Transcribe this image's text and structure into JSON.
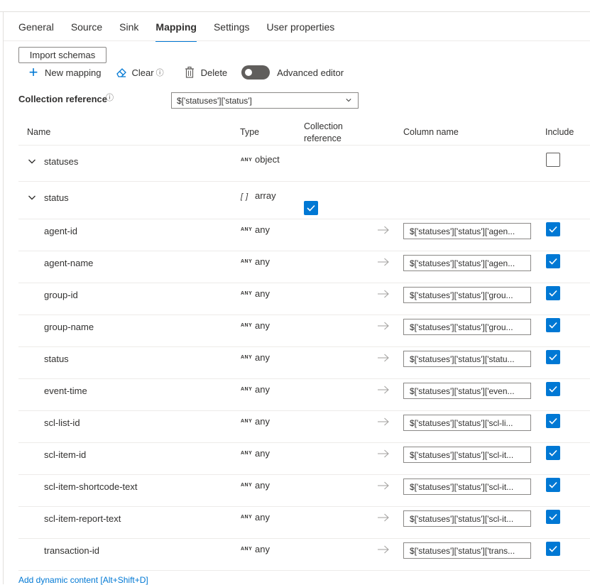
{
  "tabs": [
    {
      "label": "General"
    },
    {
      "label": "Source"
    },
    {
      "label": "Sink"
    },
    {
      "label": "Mapping",
      "active": true
    },
    {
      "label": "Settings"
    },
    {
      "label": "User properties"
    }
  ],
  "toolbar": {
    "import_schemas": "Import schemas",
    "new_mapping": "New mapping",
    "clear": "Clear",
    "delete": "Delete",
    "advanced_editor": "Advanced editor",
    "advanced_editor_on": false
  },
  "collection_reference": {
    "label": "Collection reference",
    "value": "$['statuses']['status']"
  },
  "table": {
    "headers": {
      "name": "Name",
      "type": "Type",
      "collection_reference_1": "Collection",
      "collection_reference_2": "reference",
      "column_name": "Column name",
      "include": "Include"
    },
    "rows": [
      {
        "name": "statuses",
        "type_badge": "ANY",
        "type": "object",
        "expandable": true,
        "include": false
      },
      {
        "name": "status",
        "type_badge": "[ ]",
        "type": "array",
        "expandable": true,
        "collection_ref": true
      },
      {
        "name": "agent-id",
        "type_badge": "ANY",
        "type": "any",
        "column": "$['statuses']['status']['agen...",
        "include": true
      },
      {
        "name": "agent-name",
        "type_badge": "ANY",
        "type": "any",
        "column": "$['statuses']['status']['agen...",
        "include": true
      },
      {
        "name": "group-id",
        "type_badge": "ANY",
        "type": "any",
        "column": "$['statuses']['status']['grou...",
        "include": true
      },
      {
        "name": "group-name",
        "type_badge": "ANY",
        "type": "any",
        "column": "$['statuses']['status']['grou...",
        "include": true
      },
      {
        "name": "status",
        "type_badge": "ANY",
        "type": "any",
        "column": "$['statuses']['status']['statu...",
        "include": true
      },
      {
        "name": "event-time",
        "type_badge": "ANY",
        "type": "any",
        "column": "$['statuses']['status']['even...",
        "include": true
      },
      {
        "name": "scl-list-id",
        "type_badge": "ANY",
        "type": "any",
        "column": "$['statuses']['status']['scl-li...",
        "include": true
      },
      {
        "name": "scl-item-id",
        "type_badge": "ANY",
        "type": "any",
        "column": "$['statuses']['status']['scl-it...",
        "include": true
      },
      {
        "name": "scl-item-shortcode-text",
        "type_badge": "ANY",
        "type": "any",
        "column": "$['statuses']['status']['scl-it...",
        "include": true
      },
      {
        "name": "scl-item-report-text",
        "type_badge": "ANY",
        "type": "any",
        "column": "$['statuses']['status']['scl-it...",
        "include": true
      },
      {
        "name": "transaction-id",
        "type_badge": "ANY",
        "type": "any",
        "column": "$['statuses']['status']['trans...",
        "include": true
      }
    ]
  },
  "footer_link": "Add dynamic content [Alt+Shift+D]",
  "colors": {
    "accent": "#0078d4",
    "toggle_off": "#605e5c",
    "border": "#8a8886"
  }
}
